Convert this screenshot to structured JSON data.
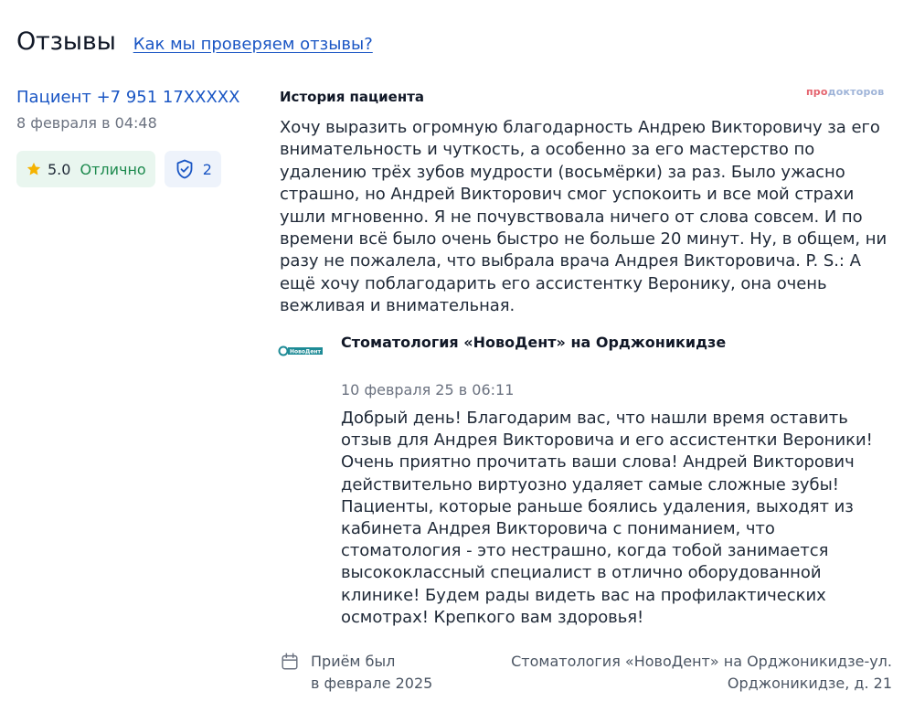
{
  "header": {
    "title": "Отзывы",
    "verify_link": "Как мы проверяем отзывы?"
  },
  "author": {
    "name": "Пациент +7 951 17XXXXX",
    "date": "8 февраля в 04:48",
    "rating_value": "5.0",
    "rating_text": "Отлично",
    "verified_count": "2",
    "icons": [
      "star-icon",
      "shield-check-icon"
    ]
  },
  "brand": {
    "part1": "про",
    "part2": "докторов"
  },
  "review": {
    "title": "История пациента",
    "text": "Хочу выразить огромную благодарность Андрею Викторовичу за его внимательность и чуткость, а особенно за его мастерство по удалению трёх зубов мудрости (восьмёрки) за раз. Было ужасно страшно, но Андрей Викторович смог успокоить и все мой страхи ушли мгновенно. Я не почувствовала ничего от слова совсем. И по времени всё было очень быстро не больше 20 минут. Ну, в общем, ни разу не пожалела, что выбрала врача Андрея Викторовича. P. S.: А ещё хочу поблагодарить его ассистентку Веронику, она очень вежливая и внимательная."
  },
  "reply": {
    "clinic_name": "Стоматология «НовоДент» на Орджоникидзе",
    "logo_text": "НовоДент",
    "date": "10 февраля 25 в 06:11",
    "text": "Добрый день! Благодарим вас, что нашли время оставить отзыв для Андрея Викторовича и его ассистентки Вероники! Очень приятно прочитать ваши слова! Андрей Викторович действительно виртуозно удаляет самые сложные зубы! Пациенты, которые раньше боялись удаления, выходят из кабинета Андрея Викторовича с пониманием, что стоматология - это нестрашно, когда тобой занимается высококлассный специалист в отлично оборудованной клинике! Будем рады видеть вас на профилактических осмотрах! Крепкого вам здоровья!"
  },
  "footer": {
    "visit_line1": "Приём был",
    "visit_line2": "в феврале 2025",
    "address_line1": "Стоматология «НовоДент» на Орджоникидзе-ул.",
    "address_line2": "Орджоникидзе, д. 21",
    "icon": "calendar-icon"
  },
  "colors": {
    "link": "#1a56c4",
    "rating_bg": "#e9f6ef",
    "rating_text": "#1d8a4e",
    "star": "#f5b301",
    "shield_bg": "#eef3fb"
  }
}
